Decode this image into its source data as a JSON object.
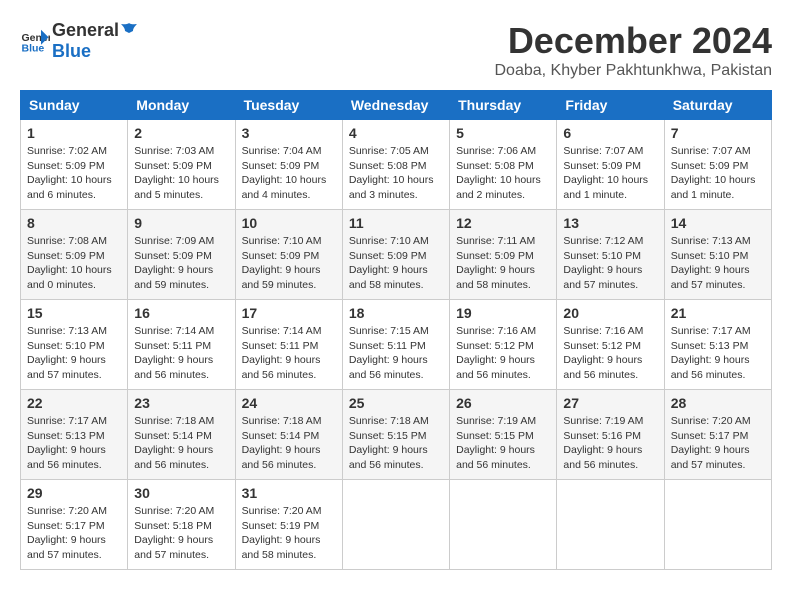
{
  "logo": {
    "general": "General",
    "blue": "Blue"
  },
  "title": "December 2024",
  "subtitle": "Doaba, Khyber Pakhtunkhwa, Pakistan",
  "headers": [
    "Sunday",
    "Monday",
    "Tuesday",
    "Wednesday",
    "Thursday",
    "Friday",
    "Saturday"
  ],
  "weeks": [
    [
      {
        "day": "1",
        "sunrise": "7:02 AM",
        "sunset": "5:09 PM",
        "daylight": "10 hours and 6 minutes."
      },
      {
        "day": "2",
        "sunrise": "7:03 AM",
        "sunset": "5:09 PM",
        "daylight": "10 hours and 5 minutes."
      },
      {
        "day": "3",
        "sunrise": "7:04 AM",
        "sunset": "5:09 PM",
        "daylight": "10 hours and 4 minutes."
      },
      {
        "day": "4",
        "sunrise": "7:05 AM",
        "sunset": "5:08 PM",
        "daylight": "10 hours and 3 minutes."
      },
      {
        "day": "5",
        "sunrise": "7:06 AM",
        "sunset": "5:08 PM",
        "daylight": "10 hours and 2 minutes."
      },
      {
        "day": "6",
        "sunrise": "7:07 AM",
        "sunset": "5:09 PM",
        "daylight": "10 hours and 1 minute."
      },
      {
        "day": "7",
        "sunrise": "7:07 AM",
        "sunset": "5:09 PM",
        "daylight": "10 hours and 1 minute."
      }
    ],
    [
      {
        "day": "8",
        "sunrise": "7:08 AM",
        "sunset": "5:09 PM",
        "daylight": "10 hours and 0 minutes."
      },
      {
        "day": "9",
        "sunrise": "7:09 AM",
        "sunset": "5:09 PM",
        "daylight": "9 hours and 59 minutes."
      },
      {
        "day": "10",
        "sunrise": "7:10 AM",
        "sunset": "5:09 PM",
        "daylight": "9 hours and 59 minutes."
      },
      {
        "day": "11",
        "sunrise": "7:10 AM",
        "sunset": "5:09 PM",
        "daylight": "9 hours and 58 minutes."
      },
      {
        "day": "12",
        "sunrise": "7:11 AM",
        "sunset": "5:09 PM",
        "daylight": "9 hours and 58 minutes."
      },
      {
        "day": "13",
        "sunrise": "7:12 AM",
        "sunset": "5:10 PM",
        "daylight": "9 hours and 57 minutes."
      },
      {
        "day": "14",
        "sunrise": "7:13 AM",
        "sunset": "5:10 PM",
        "daylight": "9 hours and 57 minutes."
      }
    ],
    [
      {
        "day": "15",
        "sunrise": "7:13 AM",
        "sunset": "5:10 PM",
        "daylight": "9 hours and 57 minutes."
      },
      {
        "day": "16",
        "sunrise": "7:14 AM",
        "sunset": "5:11 PM",
        "daylight": "9 hours and 56 minutes."
      },
      {
        "day": "17",
        "sunrise": "7:14 AM",
        "sunset": "5:11 PM",
        "daylight": "9 hours and 56 minutes."
      },
      {
        "day": "18",
        "sunrise": "7:15 AM",
        "sunset": "5:11 PM",
        "daylight": "9 hours and 56 minutes."
      },
      {
        "day": "19",
        "sunrise": "7:16 AM",
        "sunset": "5:12 PM",
        "daylight": "9 hours and 56 minutes."
      },
      {
        "day": "20",
        "sunrise": "7:16 AM",
        "sunset": "5:12 PM",
        "daylight": "9 hours and 56 minutes."
      },
      {
        "day": "21",
        "sunrise": "7:17 AM",
        "sunset": "5:13 PM",
        "daylight": "9 hours and 56 minutes."
      }
    ],
    [
      {
        "day": "22",
        "sunrise": "7:17 AM",
        "sunset": "5:13 PM",
        "daylight": "9 hours and 56 minutes."
      },
      {
        "day": "23",
        "sunrise": "7:18 AM",
        "sunset": "5:14 PM",
        "daylight": "9 hours and 56 minutes."
      },
      {
        "day": "24",
        "sunrise": "7:18 AM",
        "sunset": "5:14 PM",
        "daylight": "9 hours and 56 minutes."
      },
      {
        "day": "25",
        "sunrise": "7:18 AM",
        "sunset": "5:15 PM",
        "daylight": "9 hours and 56 minutes."
      },
      {
        "day": "26",
        "sunrise": "7:19 AM",
        "sunset": "5:15 PM",
        "daylight": "9 hours and 56 minutes."
      },
      {
        "day": "27",
        "sunrise": "7:19 AM",
        "sunset": "5:16 PM",
        "daylight": "9 hours and 56 minutes."
      },
      {
        "day": "28",
        "sunrise": "7:20 AM",
        "sunset": "5:17 PM",
        "daylight": "9 hours and 57 minutes."
      }
    ],
    [
      {
        "day": "29",
        "sunrise": "7:20 AM",
        "sunset": "5:17 PM",
        "daylight": "9 hours and 57 minutes."
      },
      {
        "day": "30",
        "sunrise": "7:20 AM",
        "sunset": "5:18 PM",
        "daylight": "9 hours and 57 minutes."
      },
      {
        "day": "31",
        "sunrise": "7:20 AM",
        "sunset": "5:19 PM",
        "daylight": "9 hours and 58 minutes."
      },
      null,
      null,
      null,
      null
    ]
  ],
  "labels": {
    "sunrise": "Sunrise:",
    "sunset": "Sunset:",
    "daylight": "Daylight:"
  }
}
